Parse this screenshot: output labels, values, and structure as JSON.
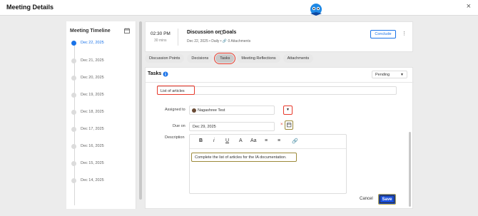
{
  "window": {
    "title": "Meeting Details",
    "close_icon": "×"
  },
  "timeline": {
    "heading": "Meeting Timeline",
    "dates": [
      {
        "label": "Dec 22, 2025",
        "active": true
      },
      {
        "label": "Dec 21, 2025",
        "active": false
      },
      {
        "label": "Dec 20, 2025",
        "active": false
      },
      {
        "label": "Dec 19, 2025",
        "active": false
      },
      {
        "label": "Dec 18, 2025",
        "active": false
      },
      {
        "label": "Dec 17, 2025",
        "active": false
      },
      {
        "label": "Dec 16, 2025",
        "active": false
      },
      {
        "label": "Dec 15, 2025",
        "active": false
      },
      {
        "label": "Dec 14, 2025",
        "active": false
      }
    ]
  },
  "meeting": {
    "time": "02:30 PM",
    "duration": "30 mins",
    "title": "Discussion on Goals",
    "meta": "Dec 22, 2025 • Daily • 🔗 0 Attachments",
    "conclude_label": "Conclude"
  },
  "tabs": [
    {
      "label": "Discussion Points",
      "active": false
    },
    {
      "label": "Decisions",
      "active": false
    },
    {
      "label": "Tasks",
      "active": true
    },
    {
      "label": "Meeting Reflections",
      "active": false
    },
    {
      "label": "Attachments",
      "active": false
    }
  ],
  "tasks": {
    "heading": "Tasks",
    "status_filter": "Pending",
    "task_title": "List of articles",
    "assigned_label": "Assigned to",
    "assignee": "Nagashree Test",
    "due_label": "Due on",
    "due_date": "Dec 29, 2025",
    "description_label": "Description",
    "description_text": "Complete the list of articles for the IA documentation.",
    "toolbar": [
      "B",
      "i",
      "U",
      "A",
      "Aa",
      "≡",
      "≡",
      "🔗"
    ],
    "cancel_label": "Cancel",
    "save_label": "Save"
  },
  "colors": {
    "accent": "#1a73e8",
    "save": "#1a4fd9",
    "highlight": "#e8392b"
  }
}
